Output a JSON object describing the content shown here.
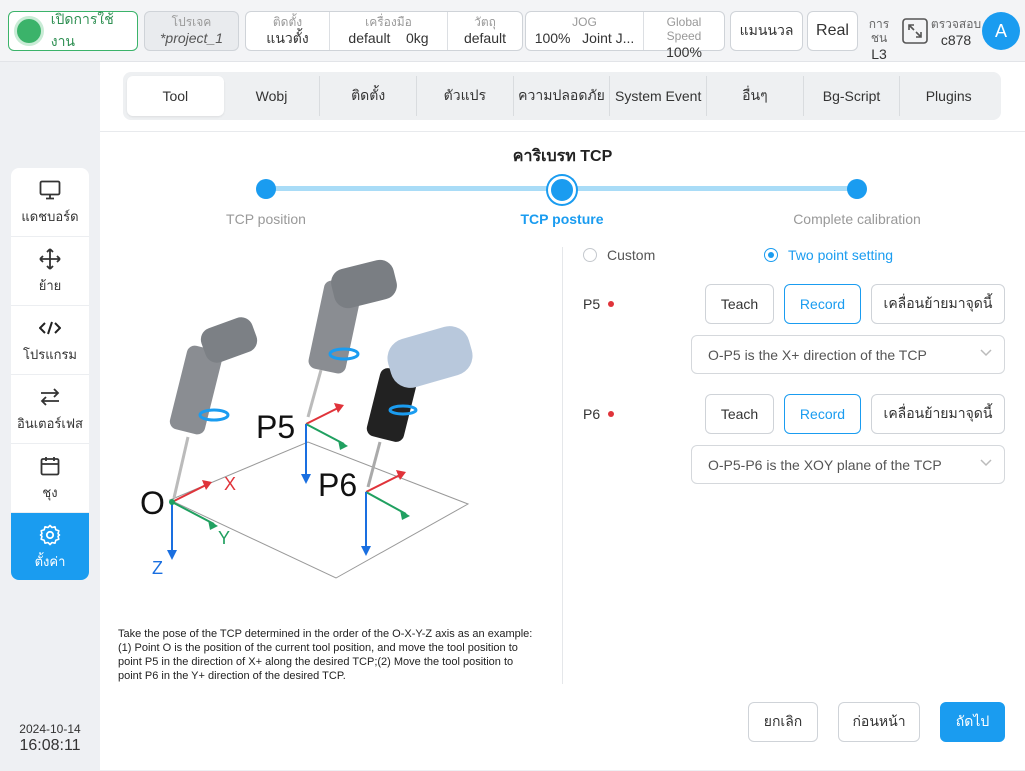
{
  "topbar": {
    "power_label": "เปิดการใช้งาน",
    "project": {
      "caption": "โปรเจค",
      "value": "*project_1"
    },
    "install": {
      "caption": "ติดตั้ง",
      "value": "แนวตั้ง"
    },
    "tool": {
      "caption": "เครื่องมือ",
      "value": "default",
      "payload": "0kg"
    },
    "wobj": {
      "caption": "วัตถุ",
      "value": "default"
    },
    "jog": {
      "caption": "JOG",
      "value": "100%",
      "mode": "Joint J..."
    },
    "speed": {
      "caption": "Global Speed",
      "value": "100%"
    },
    "manual_label": "แมนนวล",
    "real_label": "Real",
    "collision": {
      "caption": "การชน",
      "value": "L3"
    },
    "verify": {
      "caption": "ตรวจสอบ",
      "value": "c878"
    },
    "avatar_letter": "A"
  },
  "sidebar": {
    "items": [
      {
        "label": "แดชบอร์ด",
        "icon": "monitor-icon"
      },
      {
        "label": "ย้าย",
        "icon": "move-icon"
      },
      {
        "label": "โปรแกรม",
        "icon": "code-icon"
      },
      {
        "label": "อินเตอร์เฟส",
        "icon": "swap-icon"
      },
      {
        "label": "ชุง",
        "icon": "calendar-icon"
      },
      {
        "label": "ตั้งค่า",
        "icon": "gear-icon",
        "active": true
      }
    ],
    "date": "2024-10-14",
    "time": "16:08:11"
  },
  "tabs": [
    {
      "label": "Tool",
      "active": true
    },
    {
      "label": "Wobj"
    },
    {
      "label": "ติดตั้ง"
    },
    {
      "label": "ตัวแปร"
    },
    {
      "label": "ความปลอดภัย"
    },
    {
      "label": "System Event"
    },
    {
      "label": "อื่นๆ"
    },
    {
      "label": "Bg-Script"
    },
    {
      "label": "Plugins"
    }
  ],
  "calibration": {
    "title": "คาริเบรท TCP",
    "steps": [
      "TCP position",
      "TCP posture",
      "Complete calibration"
    ],
    "current_step": 2,
    "illustration_labels": {
      "o": "O",
      "x": "X",
      "y": "Y",
      "z": "Z",
      "p5": "P5",
      "p6": "P6"
    },
    "description": "Take the pose of the TCP determined in the order of the O-X-Y-Z axis as an example:(1) Point O is the position of the current tool position, and move the tool position to point P5 in the direction of X+ along the desired TCP;(2) Move the tool position to point P6 in the Y+ direction of the desired TCP.",
    "mode_custom": "Custom",
    "mode_two_point": "Two point setting",
    "selected_mode": "Two point setting",
    "points": [
      {
        "label": "P5",
        "teach": "Teach",
        "record": "Record",
        "move": "เคลื่อนย้ายมาจุดนี้",
        "select_value": "O-P5 is the X+ direction of the TCP"
      },
      {
        "label": "P6",
        "teach": "Teach",
        "record": "Record",
        "move": "เคลื่อนย้ายมาจุดนี้",
        "select_value": "O-P5-P6 is the XOY plane of the TCP"
      }
    ],
    "footer": {
      "cancel": "ยกเลิก",
      "prev": "ก่อนหน้า",
      "next": "ถัดไป"
    }
  },
  "colors": {
    "accent": "#1a9cf0",
    "power_green": "#3bb36a",
    "axis_x": "#e0333a",
    "axis_y": "#20a060",
    "axis_z": "#1a6fe0"
  }
}
